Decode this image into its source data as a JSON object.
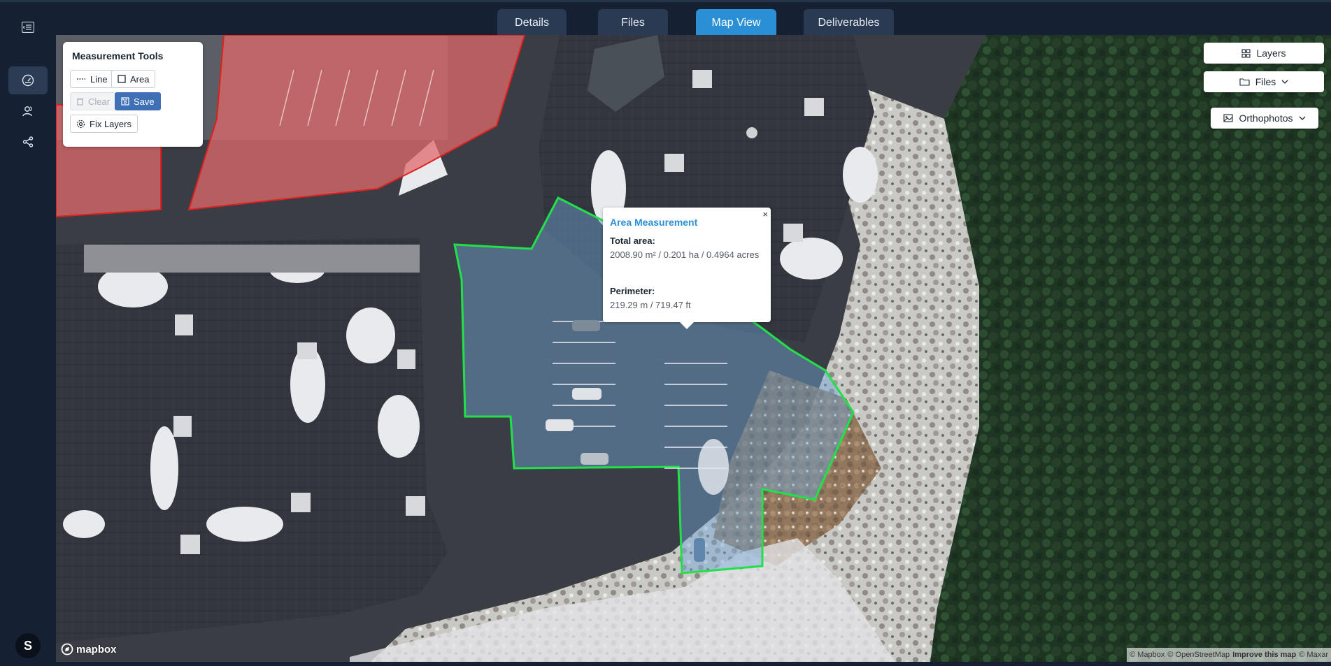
{
  "tabs": [
    {
      "label": "Details",
      "active": false
    },
    {
      "label": "Files",
      "active": false
    },
    {
      "label": "Map View",
      "active": true
    },
    {
      "label": "Deliverables",
      "active": false
    }
  ],
  "sidebar": {
    "items": [
      {
        "icon": "collapse-menu-icon"
      },
      {
        "icon": "dashboard-gauge-icon",
        "active": true
      },
      {
        "icon": "users-icon"
      },
      {
        "icon": "share-icon"
      }
    ],
    "avatar_initial": "S"
  },
  "measurement_tools": {
    "title": "Measurement Tools",
    "line_label": "Line",
    "area_label": "Area",
    "clear_label": "Clear",
    "save_label": "Save",
    "fix_layers_label": "Fix Layers"
  },
  "map_controls": {
    "layers_label": "Layers",
    "files_label": "Files",
    "orthophotos_label": "Orthophotos"
  },
  "popup": {
    "title": "Area Measurement",
    "close": "×",
    "total_area_label": "Total area:",
    "total_area_value": "2008.90 m² / 0.201 ha / 0.4964 acres",
    "perimeter_label": "Perimeter:",
    "perimeter_value": "219.29 m / 719.47 ft"
  },
  "branding": {
    "logo_text": "mapbox",
    "attribution": [
      "© Mapbox",
      "© OpenStreetMap",
      "Improve this map",
      "© Maxar"
    ]
  },
  "colors": {
    "measurement_outline": "#22e04a",
    "measurement_fill": "#6fa6d8",
    "existing_area_outline": "#e02020",
    "existing_area_fill": "#e06a6a",
    "accent": "#2b8fd6"
  }
}
